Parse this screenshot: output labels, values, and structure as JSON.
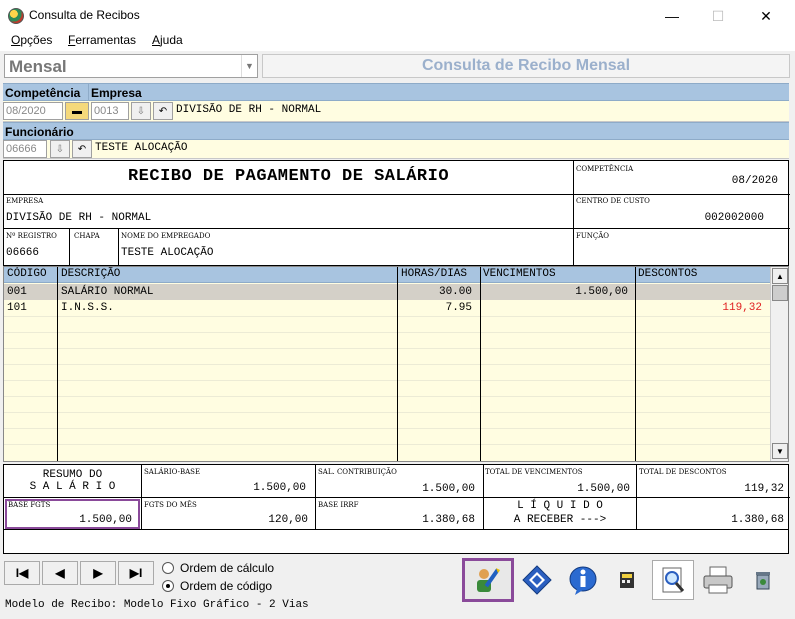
{
  "window": {
    "title": "Consulta de Recibos",
    "min": "—",
    "max": "☐",
    "close": "✕"
  },
  "menu": {
    "items": [
      {
        "accel": "O",
        "rest": "pções"
      },
      {
        "accel": "F",
        "rest": "erramentas"
      },
      {
        "accel": "A",
        "rest": "juda"
      }
    ]
  },
  "period_type": "Mensal",
  "banner": "Consulta de Recibo Mensal",
  "labels": {
    "competencia": "Competência",
    "empresa": "Empresa",
    "funcionario": "Funcionário"
  },
  "filters": {
    "competencia": "08/2020",
    "empresa_code": "0013",
    "empresa_name": "DIVISÃO DE RH - NORMAL",
    "funcionario_code": "06666",
    "funcionario_name": "TESTE ALOCAÇÃO"
  },
  "receipt": {
    "title": "RECIBO DE PAGAMENTO DE SALÁRIO",
    "competencia_label": "COMPETÊNCIA",
    "competencia": "08/2020",
    "empresa_label": "EMPRESA",
    "empresa": "DIVISÃO DE RH - NORMAL",
    "centro_label": "CENTRO DE CUSTO",
    "centro": "002002000",
    "registro_label": "Nº REGISTRO",
    "registro": "06666",
    "chapa_label": "CHAPA",
    "nome_label": "NOME DO EMPREGADO",
    "nome": "TESTE ALOCAÇÃO",
    "funcao_label": "FUNÇÃO"
  },
  "grid": {
    "headers": [
      "CÓDIGO",
      "DESCRIÇÃO",
      "HORAS/DIAS",
      "VENCIMENTOS",
      "DESCONTOS"
    ],
    "rows": [
      {
        "codigo": "001",
        "descricao": "SALÁRIO NORMAL",
        "horas": "30.00",
        "vencimentos": "1.500,00",
        "descontos": ""
      },
      {
        "codigo": "101",
        "descricao": "I.N.S.S.",
        "horas": "7.95",
        "vencimentos": "",
        "descontos": "119,32"
      }
    ]
  },
  "summary": {
    "resumo_line1": "RESUMO DO",
    "resumo_line2": "S A L Á R I O",
    "salario_base_label": "SALÁRIO-BASE",
    "salario_base": "1.500,00",
    "sal_contrib_label": "SAL. CONTRIBUIÇÃO",
    "sal_contrib": "1.500,00",
    "total_venc_label": "TOTAL DE VENCIMENTOS",
    "total_venc": "1.500,00",
    "total_desc_label": "TOTAL DE DESCONTOS",
    "total_desc": "119,32",
    "base_fgts_label": "BASE FGTS",
    "base_fgts": "1.500,00",
    "fgts_mes_label": "FGTS DO MÊS",
    "fgts_mes": "120,00",
    "base_irrf_label": "BASE IRRF",
    "base_irrf": "1.380,68",
    "liquido_line1": "L Í Q U I D O",
    "liquido_line2": "A RECEBER --->",
    "liquido": "1.380,68"
  },
  "nav": {
    "first": "I◀",
    "prev": "◀",
    "next": "▶",
    "last": "▶I"
  },
  "order": {
    "calc": "Ordem de cálculo",
    "code": "Ordem de código",
    "selected": "code"
  },
  "status": "Modelo de Recibo: Modelo Fixo Gráfico - 2 Vias",
  "colors": {
    "strip": "#a8c4e0",
    "row_yellow": "#fffde1",
    "discount_red": "#e02020",
    "highlight": "#8a4a9a"
  }
}
